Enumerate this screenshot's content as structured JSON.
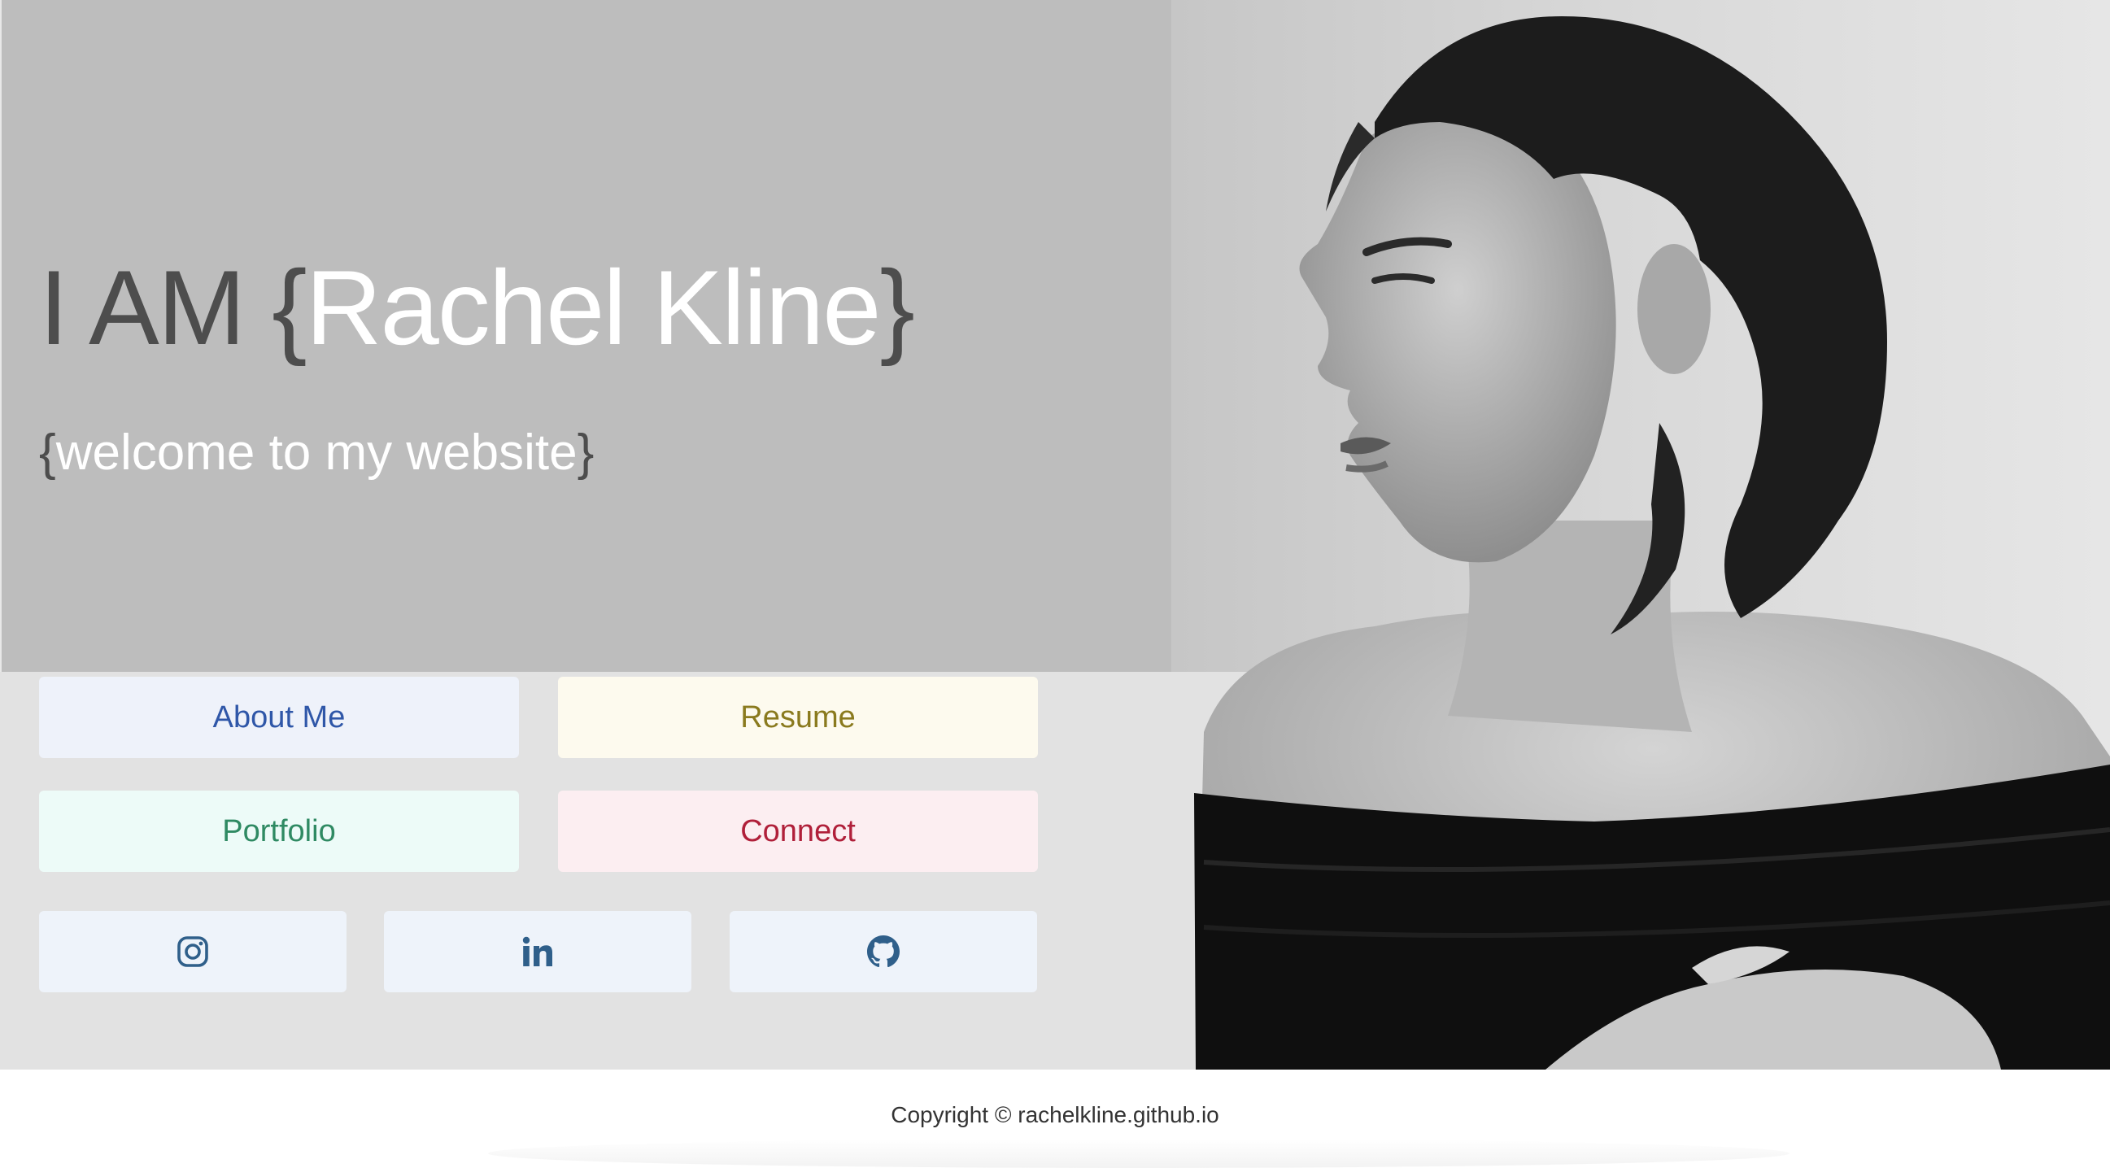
{
  "hero": {
    "title_prefix": "I AM",
    "title_open_brace": "{",
    "title_name": "Rachel Kline",
    "title_close_brace": "}",
    "subtitle_open_brace": "{",
    "subtitle_text": "welcome to my website",
    "subtitle_close_brace": "}"
  },
  "nav": {
    "about_label": "About Me",
    "resume_label": "Resume",
    "portfolio_label": "Portfolio",
    "connect_label": "Connect"
  },
  "social": [
    {
      "icon": "instagram-icon",
      "color": "#2f5f8a"
    },
    {
      "icon": "linkedin-icon",
      "color": "#2f5f8a"
    },
    {
      "icon": "github-icon",
      "color": "#2f5f8a"
    }
  ],
  "footer": {
    "copyright": "Copyright © rachelkline.github.io"
  },
  "colors": {
    "hero_top_bg": "#bdbdbd",
    "hero_bottom_bg": "#e2e2e2",
    "about_bg": "#eef2fa",
    "about_text": "#2f57a8",
    "resume_bg": "#fdfaee",
    "resume_text": "#8a7a1e",
    "portfolio_bg": "#edfbf8",
    "portfolio_text": "#2f8a63",
    "connect_bg": "#fceef1",
    "connect_text": "#b0203a"
  }
}
